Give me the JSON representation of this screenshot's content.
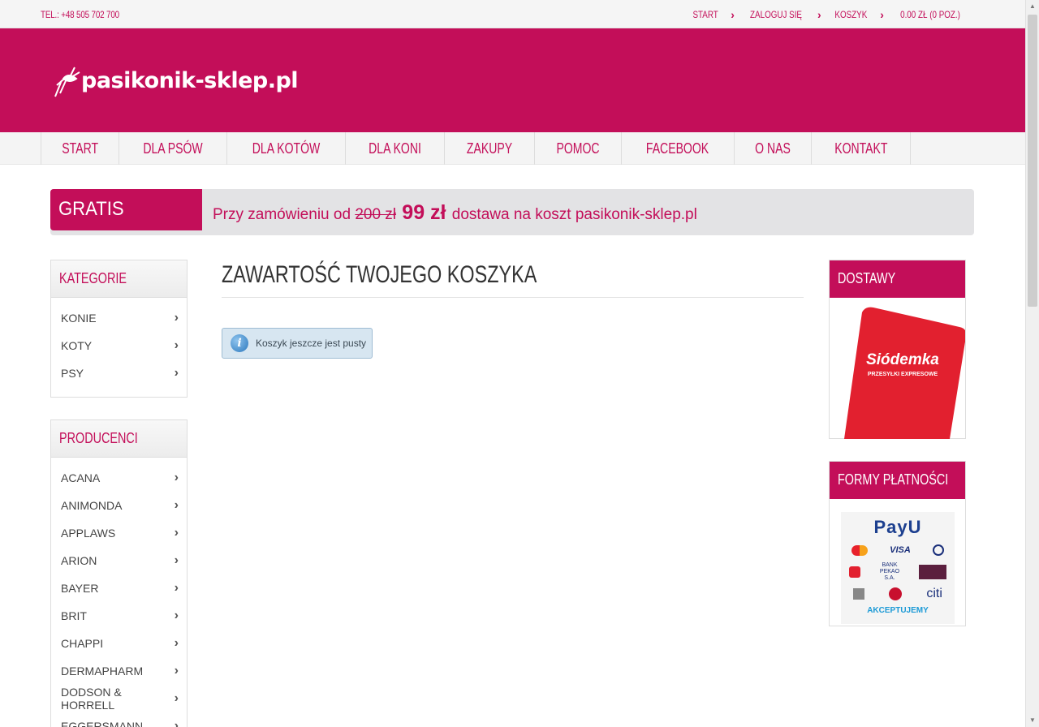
{
  "topbar": {
    "phone": "TEL.: +48 505 702 700",
    "links": [
      "START",
      "ZALOGUJ SIĘ",
      "KOSZYK",
      "0.00 ZŁ (0 POZ.)"
    ]
  },
  "logo": {
    "text": "pasikonik-sklep.pl"
  },
  "nav": [
    "START",
    "DLA PSÓW",
    "DLA KOTÓW",
    "DLA KONI",
    "ZAKUPY",
    "POMOC",
    "FACEBOOK",
    "O NAS",
    "KONTAKT"
  ],
  "promo": {
    "tag": "GRATIS",
    "text_before": "Przy zamówieniu od",
    "old_price": "200 zł",
    "new_price": "99 zł",
    "text_after": "dostawa na koszt pasikonik-sklep.pl"
  },
  "categories": {
    "title": "KATEGORIE",
    "items": [
      "KONIE",
      "KOTY",
      "PSY"
    ]
  },
  "producers": {
    "title": "PRODUCENCI",
    "items": [
      "ACANA",
      "ANIMONDA",
      "APPLAWS",
      "ARION",
      "BAYER",
      "BRIT",
      "CHAPPI",
      "DERMAPHARM",
      "DODSON & HORRELL",
      "EGGERSMANN"
    ]
  },
  "main": {
    "title": "ZAWARTOŚĆ TWOJEGO KOSZYKA",
    "notice": "Koszyk jeszcze jest pusty"
  },
  "delivery": {
    "title": "DOSTAWY",
    "brand": "Siódemka",
    "brand_sub": "PRZESYŁKI EXPRESOWE"
  },
  "payments": {
    "title": "FORMY PŁATNOŚCI",
    "logo": "PayU",
    "accept": "AKCEPTUJEMY",
    "card_labels": [
      "VISA",
      "BANK PEKAO S.A.",
      "citi"
    ]
  },
  "colors": {
    "brand": "#c30e59",
    "banner_bg": "#e3e3e5"
  }
}
